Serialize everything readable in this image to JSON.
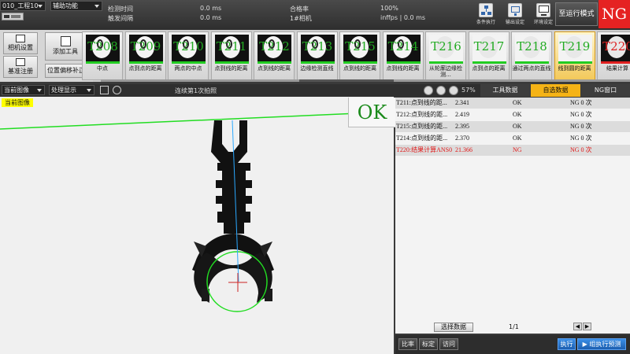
{
  "header": {
    "project": "010_工程10",
    "aux_menu": "辅助功能",
    "toolbar_chip": "",
    "stats": {
      "detect_time_label": "检测时间",
      "detect_time_value": "0.0 ms",
      "trigger_interval_label": "触发间隔",
      "trigger_interval_value": "0.0 ms",
      "pass_rate_label": "合格率",
      "pass_rate_value": "100%",
      "camera_label": "1#相机",
      "fps_value": "inffps | 0.0 ms"
    },
    "buttons": [
      {
        "label": "条件执行",
        "icon": "flowchart-icon"
      },
      {
        "label": "输出设定",
        "icon": "output-icon"
      },
      {
        "label": "环境设定",
        "icon": "monitor-icon"
      }
    ],
    "run_mode": "至运行模式",
    "result": "NG",
    "result_color": "#e52222"
  },
  "left_tools": {
    "camera_settings": "相机设置",
    "base_register": "基准注册",
    "add_tool": "添加工具",
    "position_comp": "位置偏移补正"
  },
  "tools": [
    {
      "id": "T208",
      "label": "中点",
      "ok": true
    },
    {
      "id": "T209",
      "label": "点到点的距离",
      "ok": true
    },
    {
      "id": "T210",
      "label": "两点的中点",
      "ok": true
    },
    {
      "id": "T211",
      "label": "点到线的距离",
      "ok": true
    },
    {
      "id": "T212",
      "label": "点到线的距离",
      "ok": true
    },
    {
      "id": "T213",
      "label": "边缘检测直线",
      "ok": true
    },
    {
      "id": "T215",
      "label": "点到线的距离",
      "ok": true
    },
    {
      "id": "T214",
      "label": "点到线的距离",
      "ok": true
    },
    {
      "id": "T216",
      "label": "从轮廓边缘检测...",
      "ok": true
    },
    {
      "id": "T217",
      "label": "点到点的距离",
      "ok": true
    },
    {
      "id": "T218",
      "label": "通过两点的直线",
      "ok": true
    },
    {
      "id": "T219",
      "label": "线到圆的距离",
      "ok": true,
      "selected": true
    },
    {
      "id": "T220",
      "label": "结果计算",
      "ok": false
    }
  ],
  "image_panel": {
    "view_select": "当前图像",
    "process_select": "处理显示",
    "zoom": "57%",
    "status_text": "连续第1次拍照",
    "current_tag": "当前图像",
    "overlay_result": "OK"
  },
  "right_panel": {
    "tabs": [
      "工具数据",
      "自选数据",
      "NG窗口"
    ],
    "active_tab": 1,
    "rows": [
      {
        "name": "T211:点到线的距...",
        "value": "2.341",
        "status": "OK",
        "ng": "NG 0 次",
        "bad": false
      },
      {
        "name": "T212:点到线的距...",
        "value": "2.419",
        "status": "OK",
        "ng": "NG 0 次",
        "bad": false
      },
      {
        "name": "T215:点到线的距...",
        "value": "2.395",
        "status": "OK",
        "ng": "NG 0 次",
        "bad": false
      },
      {
        "name": "T214:点到线的距...",
        "value": "2.370",
        "status": "OK",
        "ng": "NG 0 次",
        "bad": false
      },
      {
        "name": "T220:结果计算ANS0",
        "value": "21.366",
        "status": "NG",
        "ng": "NG 0 次",
        "bad": true
      }
    ],
    "select_data": "选择数据",
    "page_indicator": "1/1",
    "prev_arrow": "◀",
    "next_arrow": "▶"
  },
  "bottom": {
    "ratio": "比率",
    "calibrate": "标定",
    "visit": "访问",
    "execute": "执行",
    "group_execute": "组执行预测"
  }
}
